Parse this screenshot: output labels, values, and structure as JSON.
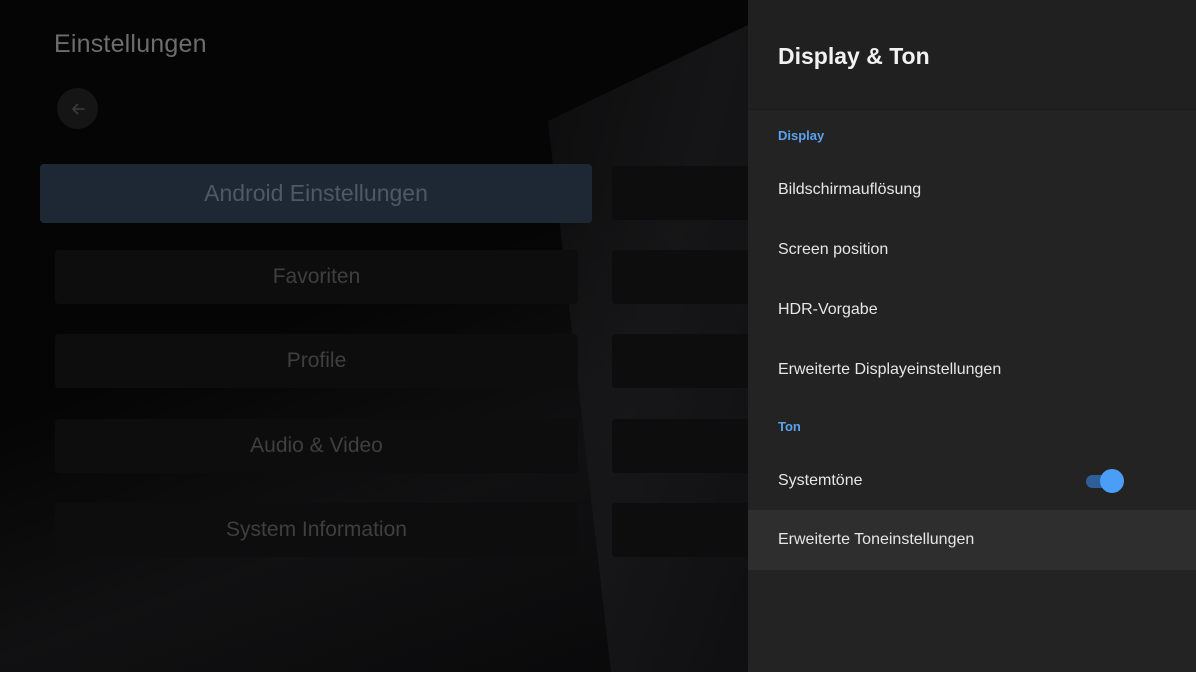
{
  "settings": {
    "title": "Einstellungen",
    "menu": [
      {
        "label": "Android Einstellungen",
        "active": true
      },
      {
        "label": "Favoriten"
      },
      {
        "label": "Profile"
      },
      {
        "label": "Audio & Video"
      },
      {
        "label": "System Information"
      }
    ]
  },
  "panel": {
    "title": "Display & Ton",
    "section_display": "Display",
    "display_items": [
      "Bildschirmauflösung",
      "Screen position",
      "HDR-Vorgabe",
      "Erweiterte Displayeinstellungen"
    ],
    "section_sound": "Ton",
    "system_sounds": {
      "label": "Systemtöne",
      "enabled": true
    },
    "advanced_sound": "Erweiterte Toneinstellungen"
  },
  "colors": {
    "accent": "#4a9ef5",
    "section_label": "#5aa2f0",
    "panel_bg": "#232323",
    "active_menu_bg": "#1e2835"
  }
}
